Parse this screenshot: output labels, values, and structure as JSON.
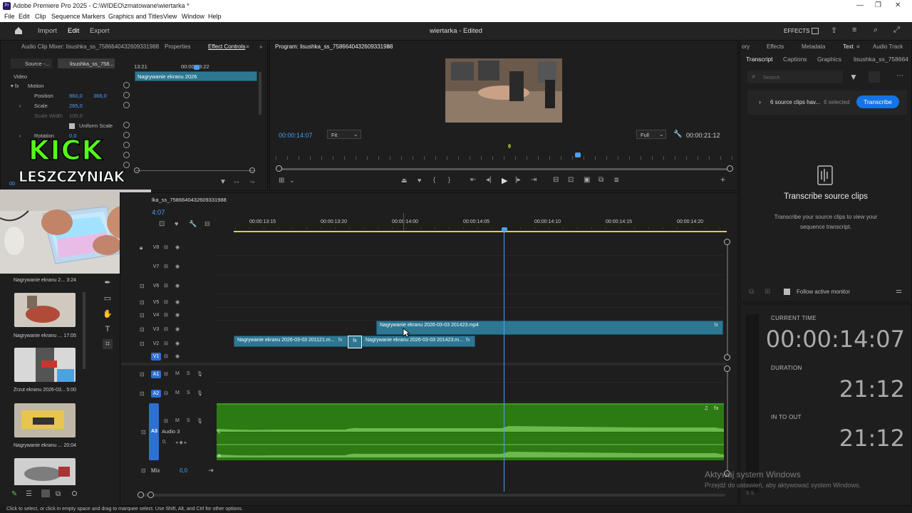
{
  "window": {
    "title": "Adobe Premiere Pro 2025 - C:\\WIDEO\\zmatowane\\wiertarka *",
    "app_icon": "Pr",
    "min": "—",
    "max": "❐",
    "close": "✕"
  },
  "menu": [
    "File",
    "Edit",
    "Clip",
    "Sequence",
    "Markers",
    "Graphics and Titles",
    "View",
    "Window",
    "Help"
  ],
  "topnav": {
    "import": "Import",
    "edit": "Edit",
    "export": "Export",
    "project_title": "wiertarka - Edited",
    "effects": "EFFECTS"
  },
  "source_panel": {
    "tabs": [
      "Audio Clip Mixer: lisushka_ss_7586640432609331988",
      "Properties",
      "Effect Controls"
    ],
    "subtabs": [
      "Source -...",
      "lisushka_ss_758..."
    ],
    "video_label": "Video",
    "motion": "Motion",
    "position_label": "Position",
    "position_x": "960,0",
    "position_y": "366,0",
    "scale_label": "Scale",
    "scale_value": "285,0",
    "scale_width_label": "Scale Width",
    "scale_width_value": "100,0",
    "uniform_scale": "Uniform Scale",
    "rotation_label": "Rotation",
    "rotation_value": "0,0",
    "ruler": [
      "13:21",
      "00:00:13:22"
    ],
    "clip_name": "Nagrywanie ekranu 2026",
    "time_peek": "00"
  },
  "overlay": {
    "line1": "KICK",
    "line2": "LESZCZYNIAK"
  },
  "program": {
    "title": "Program: lisushka_ss_7586640432609331988",
    "timecode": "00:00:14:07",
    "fit": "Fit",
    "quality": "Full",
    "duration": "00:00:21:12"
  },
  "right_tabs": {
    "row": [
      "ory",
      "Effects",
      "Metadata",
      "Text",
      "Audio Track"
    ],
    "sub": [
      "Transcript",
      "Captions",
      "Graphics",
      "lisushka_ss_758664"
    ]
  },
  "transcript": {
    "search_placeholder": "Search",
    "source_clips": "6 source clips hav...",
    "selected": "6 selected",
    "transcribe_btn": "Transcribe",
    "heading": "Transcribe source clips",
    "desc1": "Transcribe your source clips to view your",
    "desc2": "sequence transcript.",
    "follow": "Follow active monitor"
  },
  "timecode_panel": {
    "current_label": "CURRENT TIME",
    "current": "00:00:14:07",
    "duration_label": "DURATION",
    "duration": "21:12",
    "inout_label": "IN TO OUT",
    "inout": "21:12"
  },
  "timeline": {
    "tab": "lka_ss_7586640432609331988",
    "timecode": "4:07",
    "ruler": [
      "00:00:13:15",
      "00:00:13:20",
      "00:00:14:00",
      "00:00:14:05",
      "00:00:14:10",
      "00:00:14:15",
      "00:00:14:20"
    ],
    "tracks_video": [
      "V8",
      "V7",
      "V6",
      "V5",
      "V4",
      "V3",
      "V2",
      "V1"
    ],
    "tracks_audio": [
      "A1",
      "A2",
      "A3"
    ],
    "audio3_name": "Audio 3",
    "mix_label": "Mix",
    "mix_value": "0,0",
    "clip_v3": "Nagrywanie ekranu 2026-03-03 201423.mp4",
    "clip_v2a": "Nagrywanie ekranu 2026-03-03 201121.m...",
    "clip_v2b": "Nagrywanie ekranu 2026-03-03 201423.m...",
    "fx": "fx",
    "m": "M",
    "s": "S"
  },
  "project_bin": [
    {
      "name": "Nagrywanie ekranu 2...",
      "dur": "3:24"
    },
    {
      "name": "Nagrywanie ekranu ...",
      "dur": "17:05"
    },
    {
      "name": "Zrzut ekranu 2026-03...",
      "dur": "5:00"
    },
    {
      "name": "Nagrywanie ekranu ...",
      "dur": "20:04"
    }
  ],
  "status_bar": "Click to select, or click in empty space and drag to marquee select. Use Shift, Alt, and Ctrl for other options.",
  "watermark": {
    "line1": "Aktywuj system Windows",
    "line2": "Przejdź do ustawień, aby aktywować system Windows."
  }
}
